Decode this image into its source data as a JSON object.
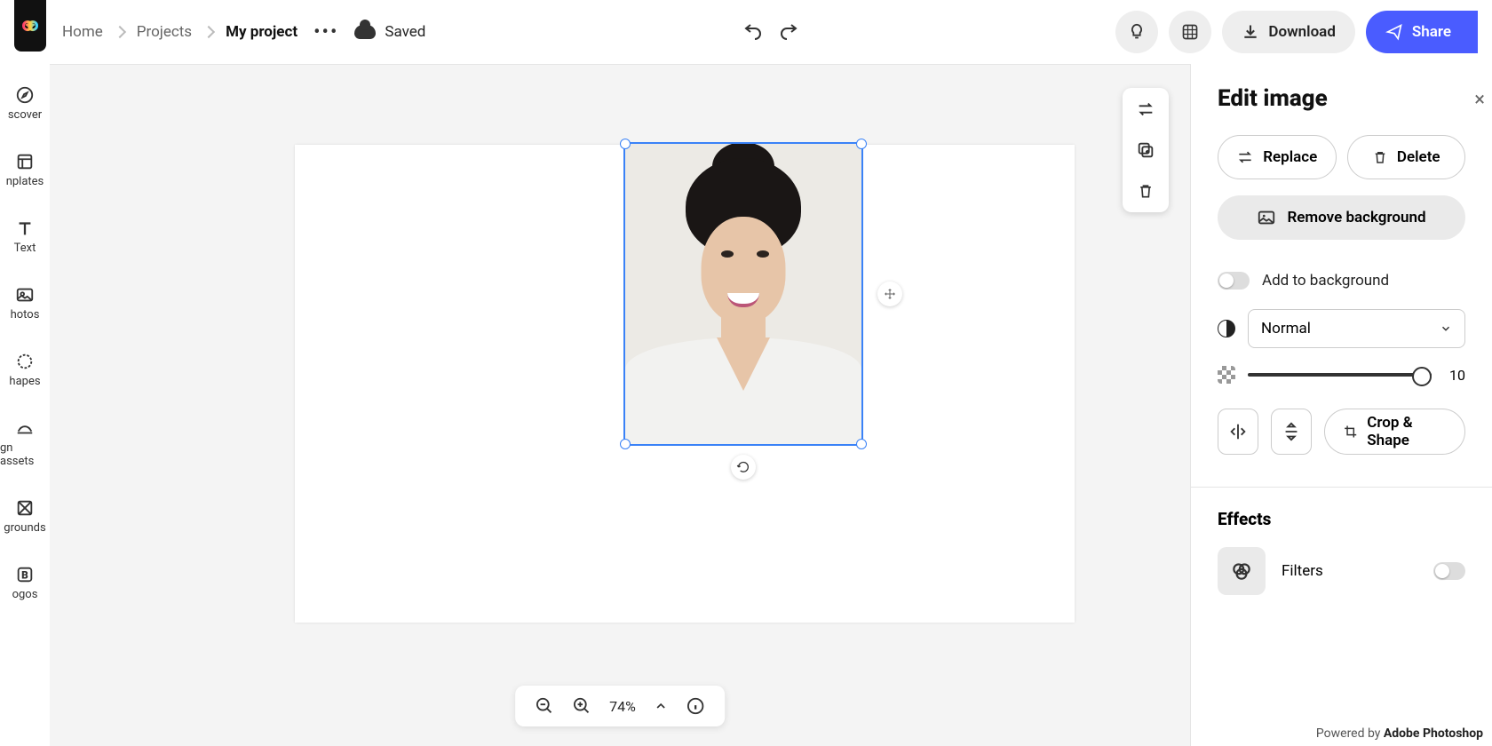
{
  "breadcrumbs": {
    "home": "Home",
    "projects": "Projects",
    "current": "My project"
  },
  "status": {
    "saved": "Saved"
  },
  "header": {
    "download": "Download",
    "share": "Share"
  },
  "sidebar": {
    "items": [
      {
        "label": "scover"
      },
      {
        "label": "nplates"
      },
      {
        "label": "Text"
      },
      {
        "label": "hotos"
      },
      {
        "label": "hapes"
      },
      {
        "label": "gn assets"
      },
      {
        "label": "grounds"
      },
      {
        "label": "ogos"
      }
    ]
  },
  "zoom": {
    "value": "74%"
  },
  "panel": {
    "title": "Edit image",
    "replace": "Replace",
    "delete": "Delete",
    "remove_bg": "Remove background",
    "add_to_bg": "Add to background",
    "blend_mode": "Normal",
    "opacity": "10",
    "crop_shape": "Crop & Shape",
    "effects_title": "Effects",
    "filters": "Filters",
    "credit_prefix": "Powered by ",
    "credit_brand": "Adobe Photoshop"
  }
}
